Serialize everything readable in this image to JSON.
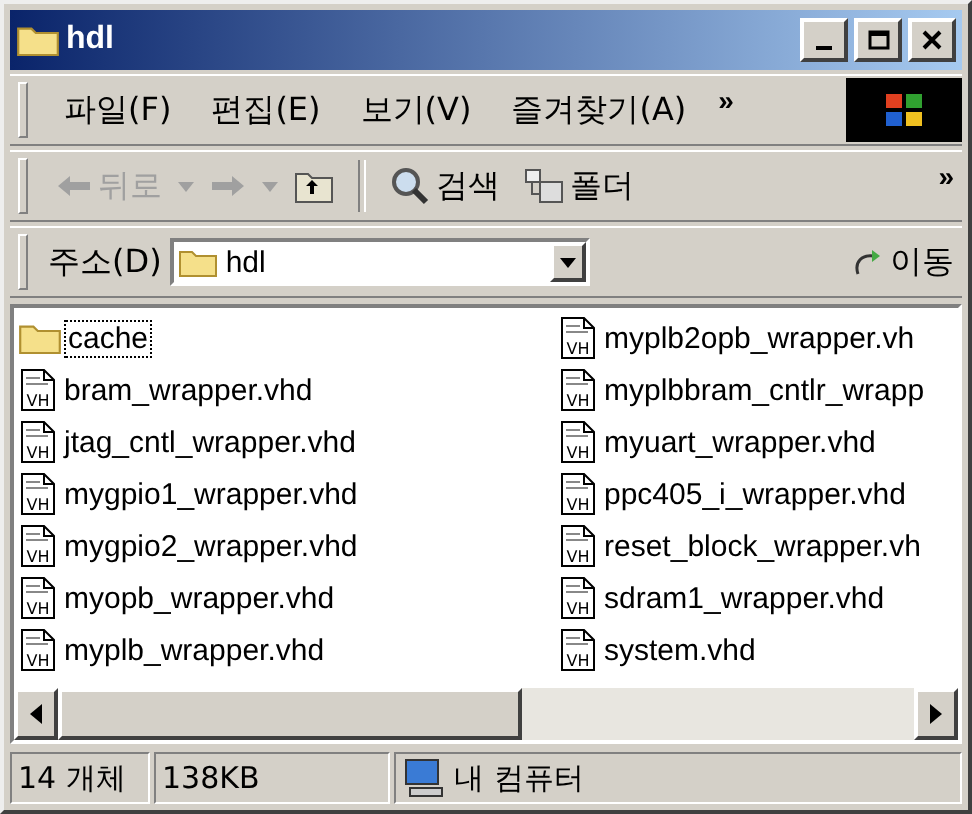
{
  "window": {
    "title": "hdl"
  },
  "menu": [
    "파일(F)",
    "편집(E)",
    "보기(V)",
    "즐겨찾기(A)"
  ],
  "menu_more": "»",
  "toolbar": {
    "back": {
      "label": "뒤로",
      "disabled": true
    },
    "forward": {
      "disabled": true
    },
    "search": "검색",
    "folders": "폴더",
    "more": "»"
  },
  "address": {
    "label": "주소(D)",
    "value": "hdl",
    "go": "이동"
  },
  "files": [
    {
      "name": "cache",
      "kind": "folder",
      "focused": true
    },
    {
      "name": "bram_wrapper.vhd",
      "kind": "vhd",
      "icon_label": "VH",
      "focused": false
    },
    {
      "name": "jtag_cntl_wrapper.vhd",
      "kind": "vhd",
      "icon_label": "VH",
      "focused": false
    },
    {
      "name": "mygpio1_wrapper.vhd",
      "kind": "vhd",
      "icon_label": "VH",
      "focused": false
    },
    {
      "name": "mygpio2_wrapper.vhd",
      "kind": "vhd",
      "icon_label": "VH",
      "focused": false
    },
    {
      "name": "myopb_wrapper.vhd",
      "kind": "vhd",
      "icon_label": "VH",
      "focused": false
    },
    {
      "name": "myplb_wrapper.vhd",
      "kind": "vhd",
      "icon_label": "VH",
      "focused": false
    },
    {
      "name": "myplb2opb_wrapper.vh",
      "kind": "vhd",
      "icon_label": "VH",
      "focused": false
    },
    {
      "name": "myplbbram_cntlr_wrapp",
      "kind": "vhd",
      "icon_label": "VH",
      "focused": false
    },
    {
      "name": "myuart_wrapper.vhd",
      "kind": "vhd",
      "icon_label": "VH",
      "focused": false
    },
    {
      "name": "ppc405_i_wrapper.vhd",
      "kind": "vhd",
      "icon_label": "VH",
      "focused": false
    },
    {
      "name": "reset_block_wrapper.vh",
      "kind": "vhd",
      "icon_label": "VH",
      "focused": false
    },
    {
      "name": "sdram1_wrapper.vhd",
      "kind": "vhd",
      "icon_label": "VH",
      "focused": false
    },
    {
      "name": "system.vhd",
      "kind": "vhd",
      "icon_label": "VH",
      "focused": false
    }
  ],
  "status_bar": {
    "count": "14 개체",
    "size": "138KB",
    "zone": "내 컴퓨터"
  }
}
